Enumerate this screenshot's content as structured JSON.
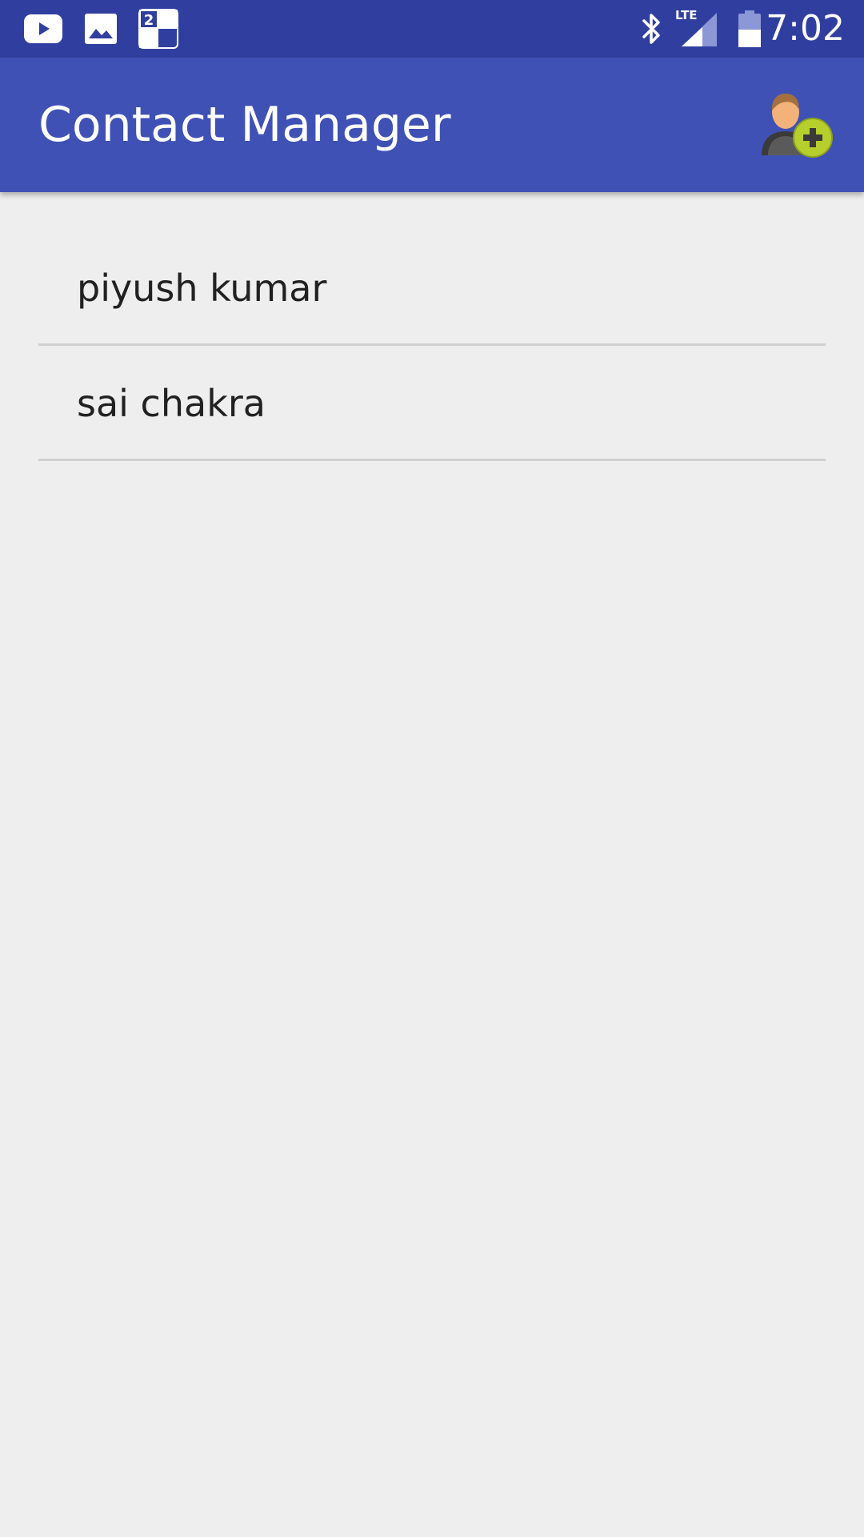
{
  "status_bar": {
    "time": "7:02",
    "network_label": "LTE",
    "left_icons": [
      "youtube-icon",
      "gallery-icon",
      "checkerboard-notification-icon"
    ],
    "right_icons": [
      "bluetooth-icon",
      "lte-signal-icon",
      "battery-icon"
    ],
    "notification_badge": "2"
  },
  "app_bar": {
    "title": "Contact Manager",
    "action_icon": "add-contact-icon"
  },
  "contacts": [
    {
      "name": "piyush kumar"
    },
    {
      "name": "sai chakra"
    }
  ],
  "colors": {
    "status_bar_bg": "#303f9f",
    "app_bar_bg": "#3f51b5",
    "page_bg": "#eeeeee",
    "divider": "#d0d0d0",
    "text_primary": "#212121"
  }
}
